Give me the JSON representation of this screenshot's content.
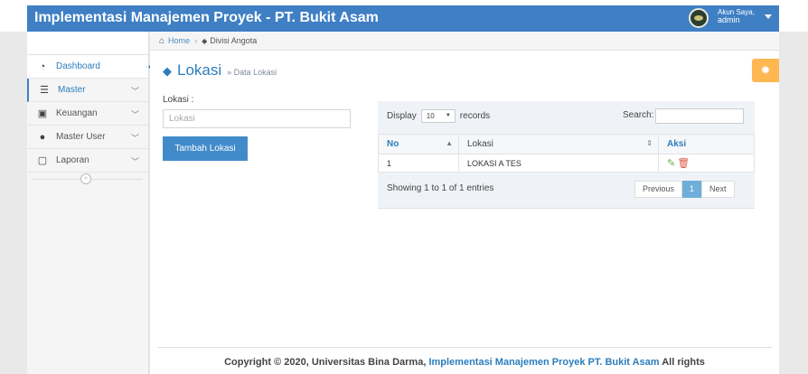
{
  "app": {
    "title": "Implementasi Manajemen Proyek - PT. Bukit Asam"
  },
  "user": {
    "greeting": "Akun Saya,",
    "name": "admin"
  },
  "sidebar": {
    "items": [
      {
        "label": "Dashboard",
        "icon": "tachometer-icon"
      },
      {
        "label": "Master",
        "icon": "list-icon"
      },
      {
        "label": "Keuangan",
        "icon": "money-icon"
      },
      {
        "label": "Master User",
        "icon": "user-icon"
      },
      {
        "label": "Laporan",
        "icon": "file-icon"
      }
    ],
    "collapse_symbol": "«"
  },
  "breadcrumb": {
    "home": "Home",
    "current": "Divisi Angota"
  },
  "page": {
    "title": "Lokasi",
    "subtitle": "» Data Lokasi"
  },
  "form": {
    "label": "Lokasi :",
    "placeholder": "Lokasi",
    "value": "",
    "add_button": "Tambah Lokasi"
  },
  "table": {
    "display_label": "Display",
    "display_value": "10",
    "records_label": "records",
    "search_label": "Search:",
    "columns": [
      "No",
      "Lokasi",
      "Aksi"
    ],
    "rows": [
      {
        "no": "1",
        "lokasi": "LOKASI A TES"
      }
    ],
    "info": "Showing 1 to 1 of 1 entries",
    "pagination": {
      "previous": "Previous",
      "current": "1",
      "next": "Next"
    }
  },
  "footer": {
    "prefix": "Copyright © 2020, Universitas Bina Darma,",
    "link": "Implementasi Manajemen Proyek PT. Bukit Asam",
    "suffix": "All rights"
  },
  "colors": {
    "navbar": "#3f7fc4",
    "accent": "#2b7dbc",
    "primary_button": "#428bca",
    "settings_button": "#ffb752"
  }
}
